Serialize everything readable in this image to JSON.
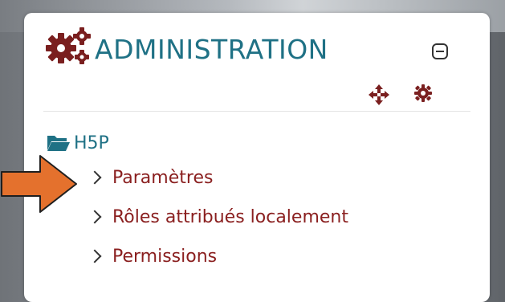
{
  "block": {
    "title": "ADMINISTRATION",
    "header_icon": "gears-icon",
    "controls": {
      "collapse_icon": "collapse-icon",
      "move_icon": "move-icon",
      "settings_icon": "gear-icon"
    },
    "tree": {
      "folder_label": "H5P",
      "folder_icon": "folder-open-icon",
      "items": [
        {
          "label": "Paramètres",
          "icon": "chevron-right-icon"
        },
        {
          "label": "Rôles attribués localement",
          "icon": "chevron-right-icon"
        },
        {
          "label": "Permissions",
          "icon": "chevron-right-icon"
        }
      ]
    }
  },
  "annotation": {
    "arrow_icon": "pointer-arrow",
    "arrow_color": "#e4712d",
    "arrow_outline": "#1f1f1f"
  },
  "colors": {
    "title": "#1f7185",
    "link": "#8a1f1f",
    "icons": "#7a1f1f"
  }
}
